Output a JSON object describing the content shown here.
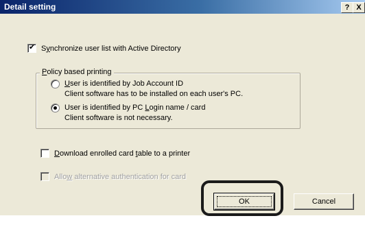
{
  "window": {
    "title": "Detail setting",
    "help_label": "?",
    "close_label": "X"
  },
  "sync": {
    "checked": true,
    "label_pre": "S",
    "label_mnemonic": "y",
    "label_post": "nchronize user list with Active Directory"
  },
  "policy": {
    "legend_mnemonic": "P",
    "legend_post": "olicy based printing",
    "option1": {
      "checked": false,
      "line1_mnemonic": "U",
      "line1_post": "ser is identified by Job Account ID",
      "line2": "Client software has to be installed on each user's PC."
    },
    "option2": {
      "checked": true,
      "line1_pre": "User is identified by PC ",
      "line1_mnemonic": "L",
      "line1_post": "ogin name / card",
      "line2": "Client software is not necessary."
    }
  },
  "download": {
    "checked": false,
    "label_mnemonic": "D",
    "label_mid": "ownload enrolled card ",
    "label_mnemonic2": "t",
    "label_post": "able to a printer"
  },
  "alternative": {
    "checked": false,
    "enabled": false,
    "label_pre": "Allo",
    "label_mnemonic": "w",
    "label_post": " alternative authentication for card"
  },
  "buttons": {
    "ok_label": "OK",
    "cancel_label": "Cancel"
  }
}
